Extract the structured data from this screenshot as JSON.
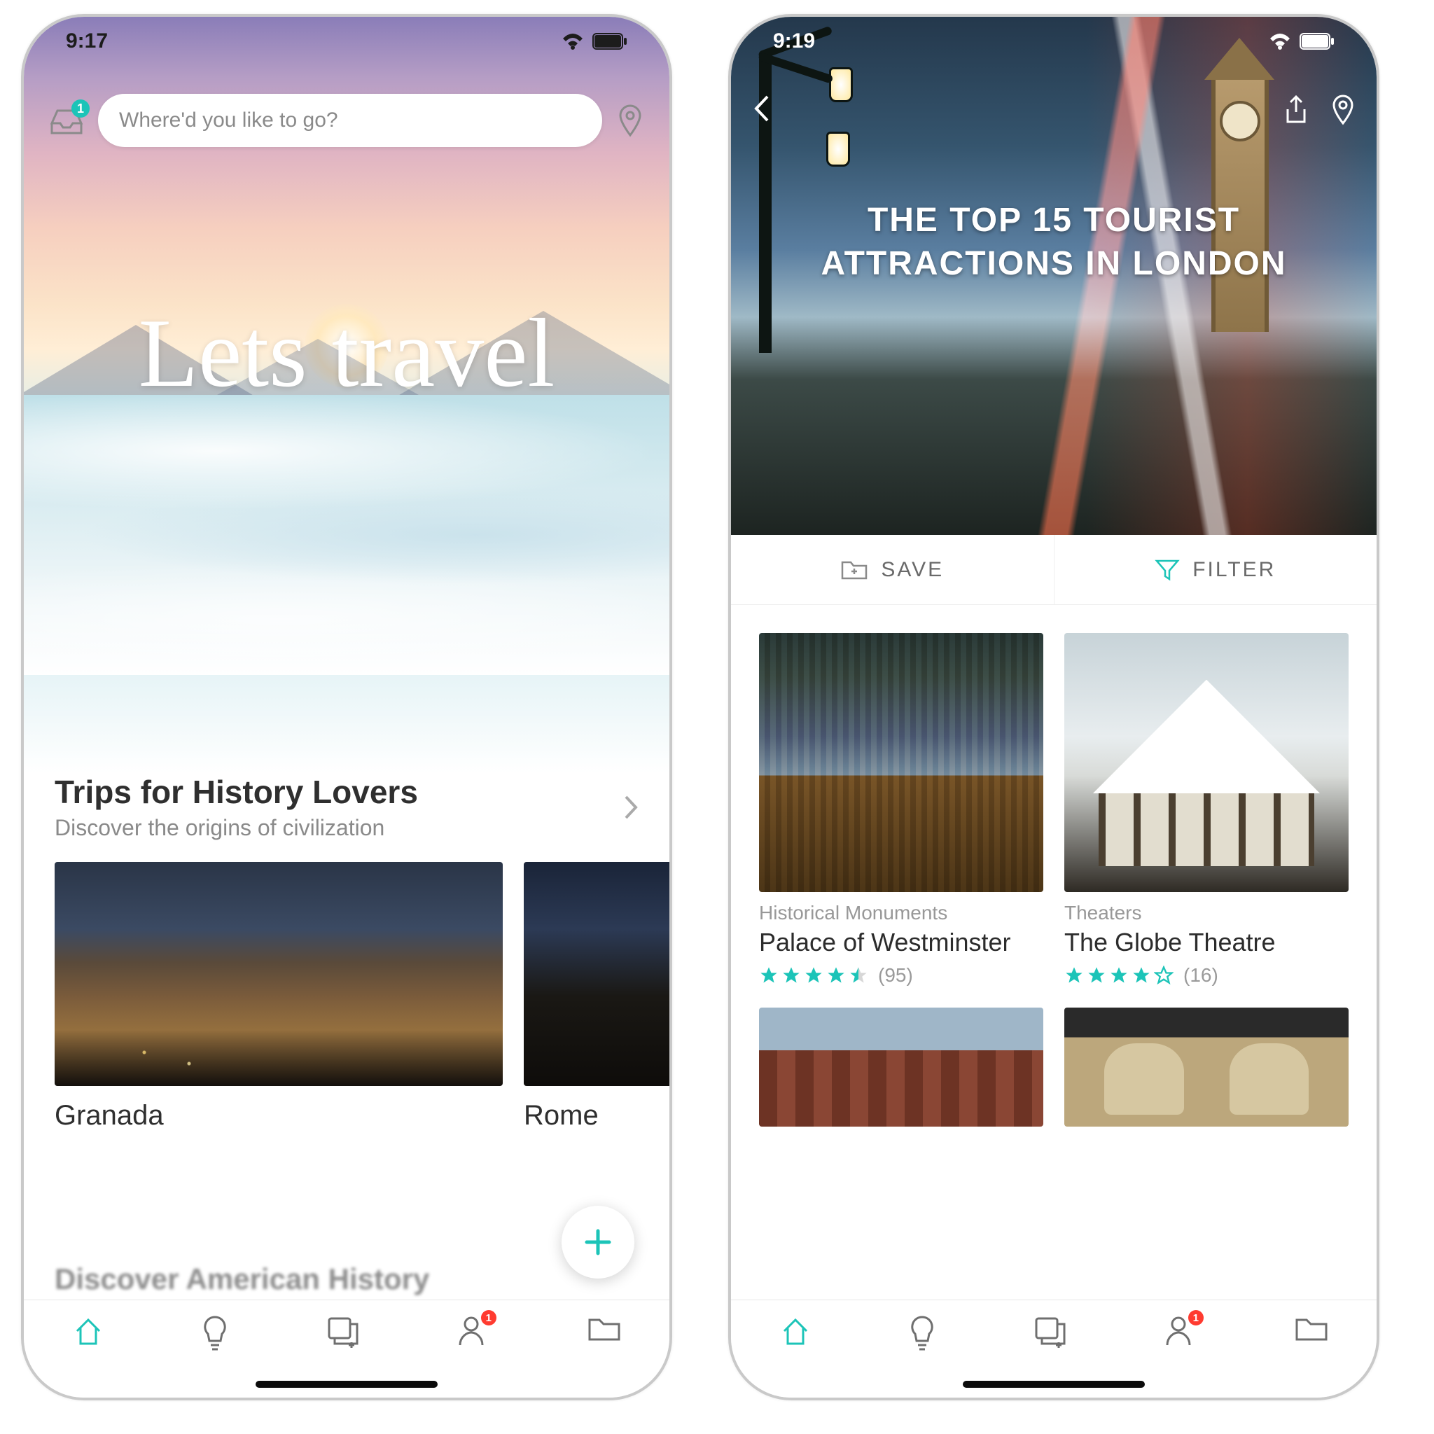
{
  "colors": {
    "accent": "#1cc4b8",
    "danger": "#ff3b30"
  },
  "phone1": {
    "status_time": "9:17",
    "inbox_badge": "1",
    "search_placeholder": "Where'd you like to go?",
    "hero_title": "Lets travel",
    "section": {
      "title": "Trips for History Lovers",
      "subtitle": "Discover the origins of civilization"
    },
    "trips": [
      {
        "label": "Granada"
      },
      {
        "label": "Rome"
      }
    ],
    "next_section_title": "Discover American History",
    "tabs_badge": "1"
  },
  "phone2": {
    "status_time": "9:19",
    "hero_title_line1": "THE TOP 15 TOURIST",
    "hero_title_line2": "ATTRACTIONS IN LONDON",
    "actions": {
      "save": "SAVE",
      "filter": "FILTER"
    },
    "attractions": [
      {
        "category": "Historical Monuments",
        "name": "Palace of Westminster",
        "rating": 4.5,
        "reviews": "(95)"
      },
      {
        "category": "Theaters",
        "name": "The Globe Theatre",
        "rating": 4.0,
        "reviews": "(16)"
      }
    ],
    "tabs_badge": "1"
  }
}
